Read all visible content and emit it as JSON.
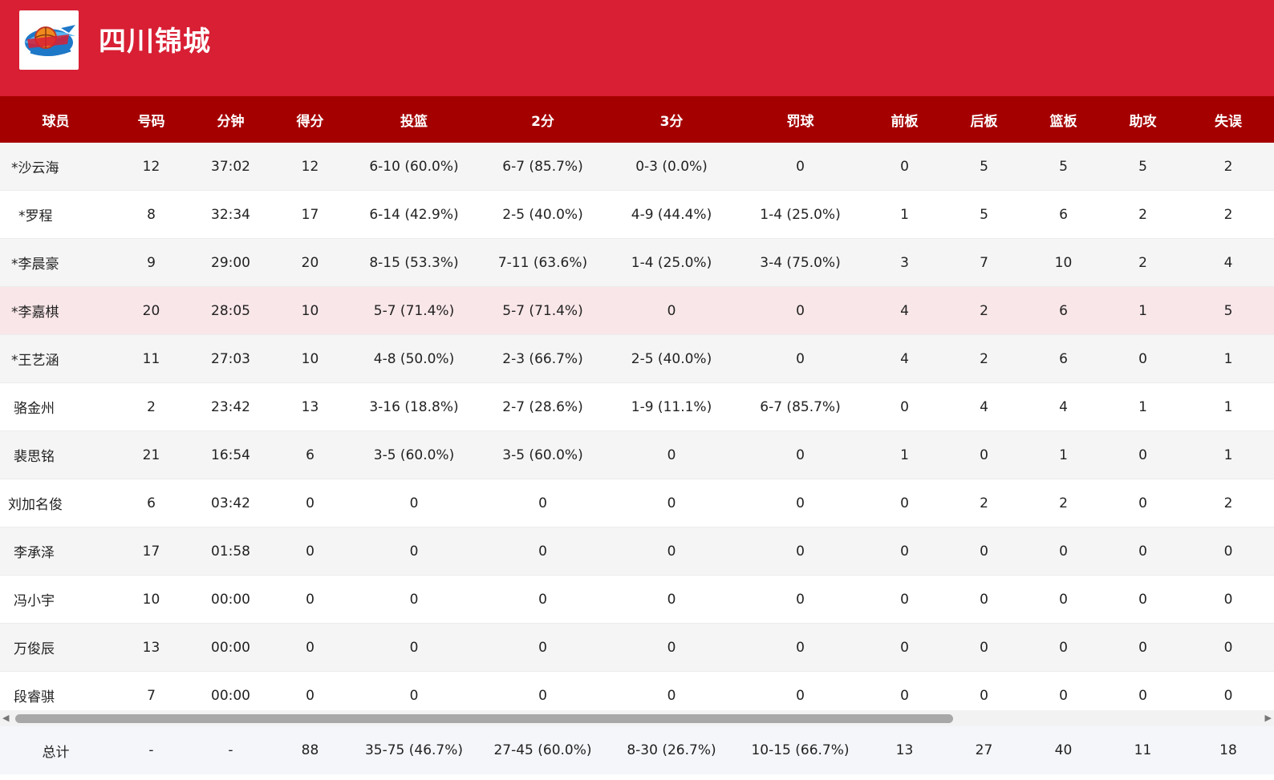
{
  "team": {
    "name": "四川锦城",
    "logo_icon": "sichuan-team-logo"
  },
  "colors": {
    "header_bg": "#d81f34",
    "table_header_bg": "#a50000"
  },
  "columns": [
    "球员",
    "号码",
    "分钟",
    "得分",
    "投篮",
    "2分",
    "3分",
    "罚球",
    "前板",
    "后板",
    "篮板",
    "助攻",
    "失误"
  ],
  "rows": [
    [
      "*沙云海",
      "12",
      "37:02",
      "12",
      "6-10 (60.0%)",
      "6-7 (85.7%)",
      "0-3 (0.0%)",
      "0",
      "0",
      "5",
      "5",
      "5",
      "2"
    ],
    [
      "*罗程",
      "8",
      "32:34",
      "17",
      "6-14 (42.9%)",
      "2-5 (40.0%)",
      "4-9 (44.4%)",
      "1-4 (25.0%)",
      "1",
      "5",
      "6",
      "2",
      "2"
    ],
    [
      "*李晨豪",
      "9",
      "29:00",
      "20",
      "8-15 (53.3%)",
      "7-11 (63.6%)",
      "1-4 (25.0%)",
      "3-4 (75.0%)",
      "3",
      "7",
      "10",
      "2",
      "4"
    ],
    [
      "*李嘉棋",
      "20",
      "28:05",
      "10",
      "5-7 (71.4%)",
      "5-7 (71.4%)",
      "0",
      "0",
      "4",
      "2",
      "6",
      "1",
      "5"
    ],
    [
      "*王艺涵",
      "11",
      "27:03",
      "10",
      "4-8 (50.0%)",
      "2-3 (66.7%)",
      "2-5 (40.0%)",
      "0",
      "4",
      "2",
      "6",
      "0",
      "1"
    ],
    [
      "骆金州",
      "2",
      "23:42",
      "13",
      "3-16 (18.8%)",
      "2-7 (28.6%)",
      "1-9 (11.1%)",
      "6-7 (85.7%)",
      "0",
      "4",
      "4",
      "1",
      "1"
    ],
    [
      "裴思铭",
      "21",
      "16:54",
      "6",
      "3-5 (60.0%)",
      "3-5 (60.0%)",
      "0",
      "0",
      "1",
      "0",
      "1",
      "0",
      "1"
    ],
    [
      "刘加名俊",
      "6",
      "03:42",
      "0",
      "0",
      "0",
      "0",
      "0",
      "0",
      "2",
      "2",
      "0",
      "2"
    ],
    [
      "李承泽",
      "17",
      "01:58",
      "0",
      "0",
      "0",
      "0",
      "0",
      "0",
      "0",
      "0",
      "0",
      "0"
    ],
    [
      "冯小宇",
      "10",
      "00:00",
      "0",
      "0",
      "0",
      "0",
      "0",
      "0",
      "0",
      "0",
      "0",
      "0"
    ],
    [
      "万俊辰",
      "13",
      "00:00",
      "0",
      "0",
      "0",
      "0",
      "0",
      "0",
      "0",
      "0",
      "0",
      "0"
    ],
    [
      "段睿骐",
      "7",
      "00:00",
      "0",
      "0",
      "0",
      "0",
      "0",
      "0",
      "0",
      "0",
      "0",
      "0"
    ]
  ],
  "totals": [
    "总计",
    "-",
    "-",
    "88",
    "35-75 (46.7%)",
    "27-45 (60.0%)",
    "8-30 (26.7%)",
    "10-15 (66.7%)",
    "13",
    "27",
    "40",
    "11",
    "18"
  ],
  "scrollbar": {
    "left_arrow": "◀",
    "right_arrow": "▶"
  }
}
